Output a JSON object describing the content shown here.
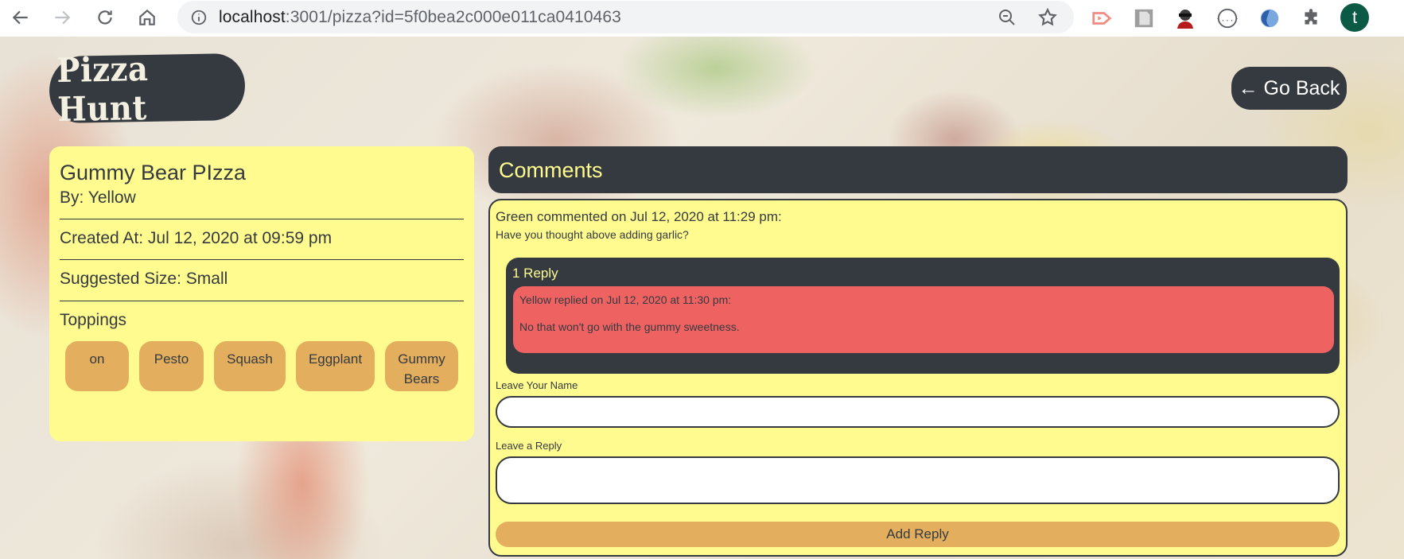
{
  "browser": {
    "url_host": "localhost",
    "url_rest": ":3001/pizza?id=5f0bea2c000e011ca0410463",
    "profile_initial": "t",
    "icons": [
      "back-arrow-icon",
      "forward-arrow-icon",
      "reload-icon",
      "home-icon",
      "info-icon",
      "zoom-out-icon",
      "bookmark-star-icon",
      "extension-icons",
      "puzzle-icon"
    ]
  },
  "header": {
    "logo": "Pizza Hunt",
    "back_button": "← Go Back"
  },
  "pizza": {
    "name": "Gummy Bear PIzza",
    "by": "By: Yellow",
    "created": "Created At: Jul 12, 2020 at 09:59 pm",
    "size": "Suggested Size: Small",
    "toppings_title": "Toppings",
    "toppings": [
      "on",
      "Pesto",
      "Squash",
      "Eggplant",
      "Gummy Bears"
    ]
  },
  "comments": {
    "title": "Comments",
    "items": [
      {
        "author_line": "Green commented on Jul 12, 2020 at 11:29 pm:",
        "text": "Have you thought above adding garlic?",
        "replies_title": "1 Reply",
        "replies": [
          {
            "author_line": "Yellow replied on Jul 12, 2020 at 11:30 pm:",
            "text": "No that won't go with the gummy sweetness."
          }
        ],
        "name_label": "Leave Your Name",
        "name_value": "",
        "reply_label": "Leave a Reply",
        "reply_value": "",
        "submit_label": "Add Reply"
      }
    ]
  },
  "colors": {
    "dark": "#343a40",
    "yellow": "#fffb8f",
    "orange": "#e3ae5d",
    "red": "#ef6262"
  }
}
